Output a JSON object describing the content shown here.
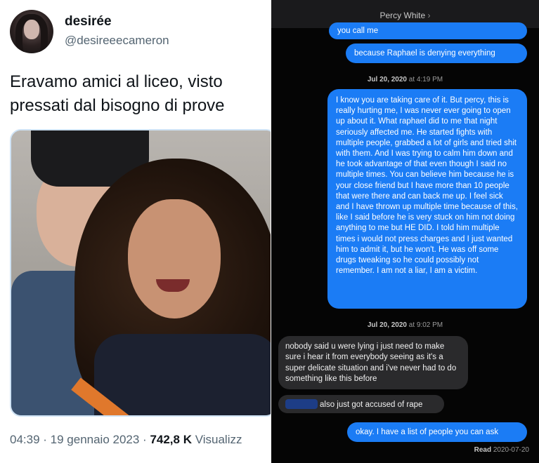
{
  "tweet": {
    "display_name": "desirée",
    "handle": "@desireeecameron",
    "text_line1": "Eravamo amici al liceo, visto",
    "text_line2": "pressati dal bisogno di prove",
    "time": "04:39 · 19 gennaio 2023 · ",
    "views": "742,8 K",
    "views_label": " Visualizz"
  },
  "messages": {
    "contact_name": "Percy White",
    "contact_chevron": "›",
    "items": [
      {
        "text": "you call me"
      },
      {
        "text": "because Raphael is denying everything"
      },
      {
        "ts_day": "Jul 20, 2020",
        "ts_time": " at 4:19 PM"
      },
      {
        "text": "I know you are taking care of it. But percy, this is really hurting me, I was never ever going to open up about it. What raphael did to me that night seriously affected me. He started fights with multiple people, grabbed a lot of girls and tried shit with them. And I was trying to calm him down and he took advantage of that even though I said no multiple times. You can believe him because he is your close friend but I have more than 10 people that were there and can back me up. I feel sick and I have thrown up multiple time because of this, like I said before he is very stuck on him not doing anything to me but HE DID. I told him multiple times i would not press charges and I just wanted him to admit it, but he won't. He was off some drugs tweaking so he could possibly not remember. I am not a liar, I am a victim."
      },
      {
        "ts_day": "Jul 20, 2020",
        "ts_time": " at 9:02 PM"
      },
      {
        "text": "nobody said u were lying i just need to make sure i hear it from everybody seeing as it's a super delicate situation and i've never had to do something like this before"
      },
      {
        "text": "also just got accused of rape"
      },
      {
        "text": "okay. I have a list of people you can ask"
      }
    ],
    "read_label": "Read",
    "read_date": " 2020-07-20"
  },
  "colors": {
    "sent_bubble": "#1b7cf5",
    "received_bubble": "#2a2a2c",
    "chat_background": "#050505",
    "redaction": "#1d3d86"
  }
}
